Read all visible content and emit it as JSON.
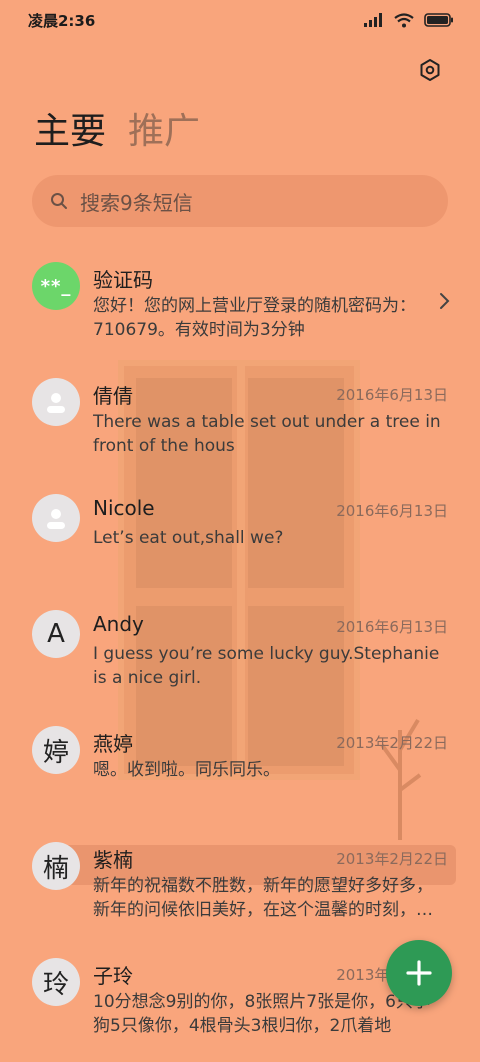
{
  "status_bar": {
    "time": "凌晨2:36"
  },
  "tabs": [
    {
      "label": "主要"
    },
    {
      "label": "推广"
    }
  ],
  "search": {
    "placeholder": "搜索9条短信"
  },
  "messages": [
    {
      "avatar_text": "**_",
      "name": "验证码",
      "date": "",
      "preview": "您好！您的网上营业厅登录的随机密码为：710679。有效时间为3分钟"
    },
    {
      "avatar_text": "",
      "name": "倩倩",
      "date": "2016年6月13日",
      "preview": "There was a table set out under a tree in front of the hous"
    },
    {
      "avatar_text": "",
      "name": "Nicole",
      "date": "2016年6月13日",
      "preview": "Let’s eat out,shall we?"
    },
    {
      "avatar_text": "A",
      "name": "Andy",
      "date": "2016年6月13日",
      "preview": "I guess you’re some lucky guy.Stephanie is a nice girl."
    },
    {
      "avatar_text": "婷",
      "name": "燕婷",
      "date": "2013年2月22日",
      "preview": "嗯。收到啦。同乐同乐。"
    },
    {
      "avatar_text": "楠",
      "name": "紫楠",
      "date": "2013年2月22日",
      "preview": "新年的祝福数不胜数，新年的愿望好多好多，新年的问候依旧美好，在这个温馨的时刻，…"
    },
    {
      "avatar_text": "玲",
      "name": "子玲",
      "date": "2013年2月22日",
      "preview": "10分想念9别的你，8张照片7张是你，6只小狗5只像你，4根骨头3根归你，2爪着地"
    }
  ],
  "colors": {
    "background": "#F9A57C",
    "fab": "#2E9A55",
    "verify_avatar": "#6CD66A"
  }
}
